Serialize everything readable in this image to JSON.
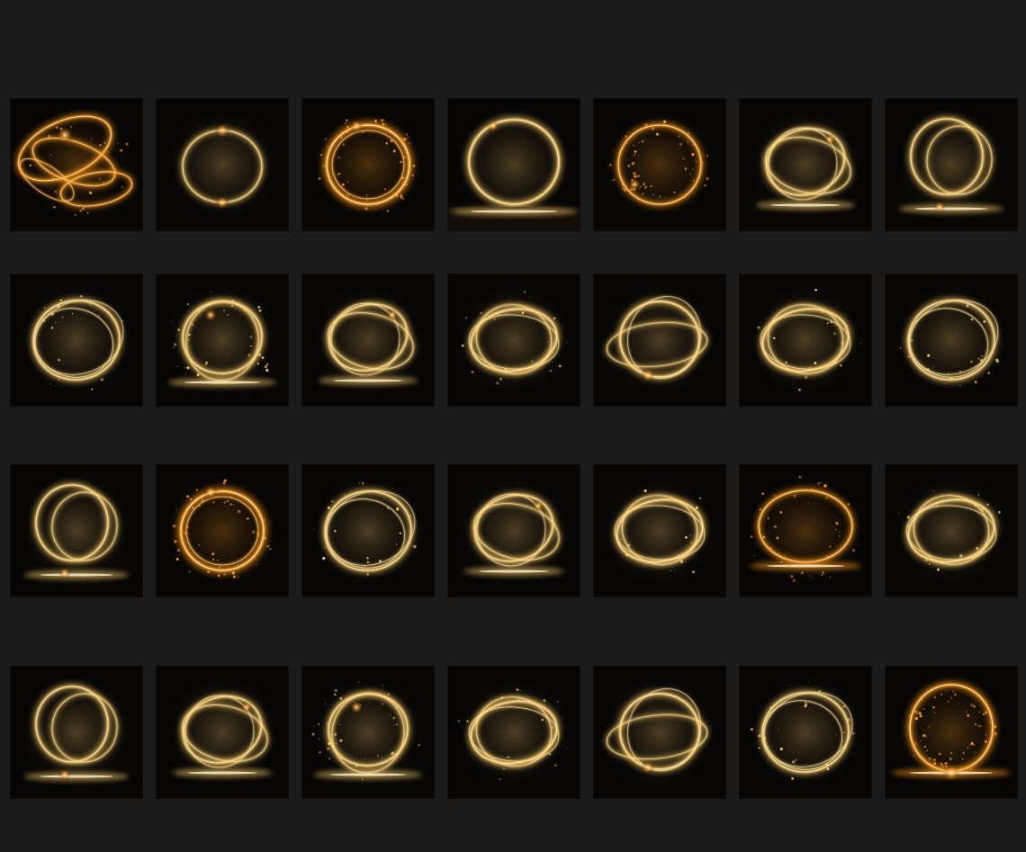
{
  "gallery": {
    "rows": [
      [
        {
          "variant": "swirl-cluster",
          "palette": "amber-orange"
        },
        {
          "variant": "thin-ring",
          "palette": "gold"
        },
        {
          "variant": "ember-ring",
          "palette": "amber-orange"
        },
        {
          "variant": "ring-on-stage",
          "palette": "gold"
        },
        {
          "variant": "sparkle-ring",
          "palette": "amber-orange"
        },
        {
          "variant": "tilted-loops",
          "palette": "gold"
        },
        {
          "variant": "loops-on-floor",
          "palette": "gold"
        }
      ],
      [
        {
          "variant": "wispy-ring",
          "palette": "gold"
        },
        {
          "variant": "double-ring-floor",
          "palette": "gold"
        },
        {
          "variant": "tilted-loops",
          "palette": "gold"
        },
        {
          "variant": "oval-rings",
          "palette": "gold"
        },
        {
          "variant": "ring-streaks",
          "palette": "gold"
        },
        {
          "variant": "oval-rings",
          "palette": "gold"
        },
        {
          "variant": "wispy-ring",
          "palette": "gold"
        }
      ],
      [
        {
          "variant": "loops-on-floor",
          "palette": "gold"
        },
        {
          "variant": "ember-ring",
          "palette": "amber-orange"
        },
        {
          "variant": "wispy-ring",
          "palette": "gold"
        },
        {
          "variant": "tilted-loops",
          "palette": "gold"
        },
        {
          "variant": "oval-rings",
          "palette": "gold"
        },
        {
          "variant": "glow-floor-oval",
          "palette": "amber-orange"
        },
        {
          "variant": "oval-rings",
          "palette": "gold"
        }
      ],
      [
        {
          "variant": "loops-on-floor",
          "palette": "gold"
        },
        {
          "variant": "tilted-loops",
          "palette": "gold"
        },
        {
          "variant": "double-ring-floor",
          "palette": "gold"
        },
        {
          "variant": "oval-rings",
          "palette": "gold"
        },
        {
          "variant": "ring-streaks",
          "palette": "gold"
        },
        {
          "variant": "wispy-ring",
          "palette": "gold"
        },
        {
          "variant": "portal-fire",
          "palette": "amber-orange"
        }
      ]
    ],
    "colors": {
      "background": "#1b1b1b",
      "tile": "#070605",
      "gold": "#ffcf6a",
      "amber": "#ff9a1f",
      "core": "#fff4d6"
    }
  }
}
